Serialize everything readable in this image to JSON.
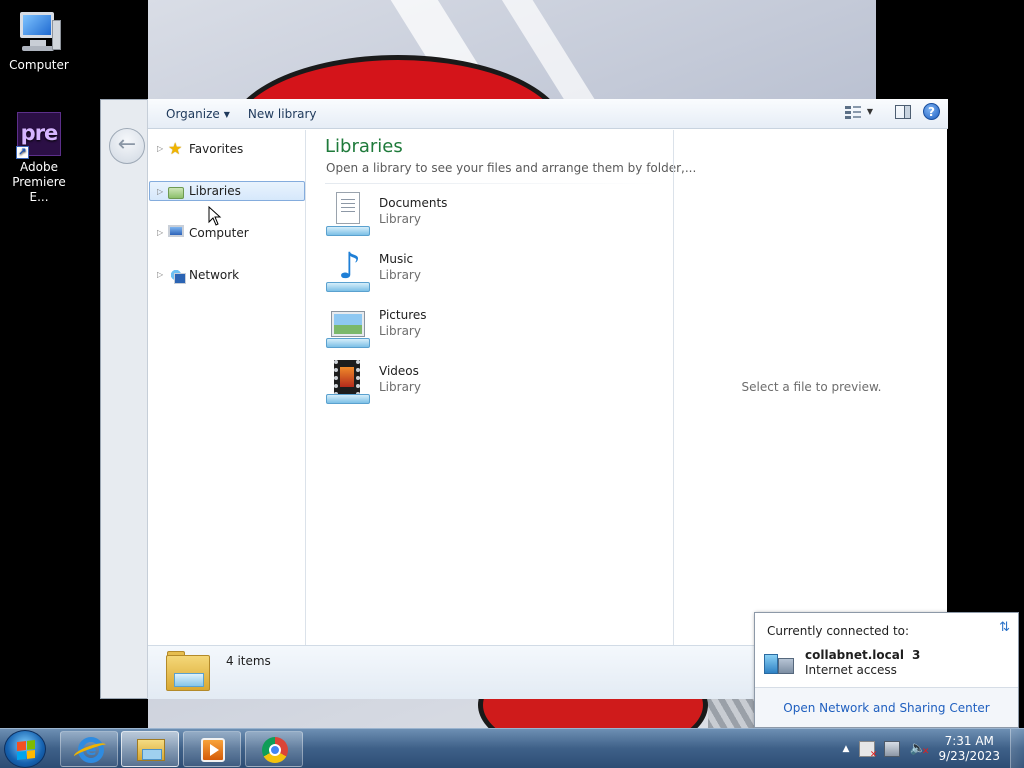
{
  "desktop": {
    "icons": [
      {
        "label": "Computer",
        "icon": "computer-icon"
      },
      {
        "label": "Adobe Premiere E...",
        "label_line1": "Adobe",
        "label_line2": "Premiere E...",
        "icon": "premiere-icon",
        "icon_text": "pre"
      }
    ]
  },
  "explorer": {
    "toolbar": {
      "organize_label": "Organize",
      "new_library_label": "New library"
    },
    "nav": {
      "items": [
        {
          "label": "Favorites",
          "icon": "star-icon",
          "selected": false
        },
        {
          "label": "Libraries",
          "icon": "libraries-icon",
          "selected": true
        },
        {
          "label": "Computer",
          "icon": "computer-icon",
          "selected": false
        },
        {
          "label": "Network",
          "icon": "network-icon",
          "selected": false
        }
      ]
    },
    "main": {
      "title": "Libraries",
      "subtitle": "Open a library to see your files and arrange them by folder,...",
      "libraries": [
        {
          "name": "Documents",
          "type": "Library",
          "icon": "documents-library-icon"
        },
        {
          "name": "Music",
          "type": "Library",
          "icon": "music-library-icon"
        },
        {
          "name": "Pictures",
          "type": "Library",
          "icon": "pictures-library-icon"
        },
        {
          "name": "Videos",
          "type": "Library",
          "icon": "videos-library-icon"
        }
      ]
    },
    "preview": {
      "text": "Select a file to preview."
    },
    "details": {
      "count": "4 items"
    }
  },
  "network_popup": {
    "header": "Currently connected to:",
    "network_name": "collabnet.local",
    "network_number": "3",
    "access": "Internet access",
    "link": "Open Network and Sharing Center"
  },
  "taskbar": {
    "apps": [
      {
        "name": "Internet Explorer",
        "icon": "ie-icon"
      },
      {
        "name": "Windows Explorer",
        "icon": "folder-icon",
        "active": true
      },
      {
        "name": "Windows Media Player",
        "icon": "media-player-icon"
      },
      {
        "name": "Google Chrome",
        "icon": "chrome-icon"
      }
    ],
    "clock": {
      "time": "7:31 AM",
      "date": "9/23/2023"
    }
  },
  "colors": {
    "library_title": "#1e7a3a",
    "link": "#1f5fbf",
    "taskbar": "#3e6088",
    "selection_border": "#84acdd"
  }
}
